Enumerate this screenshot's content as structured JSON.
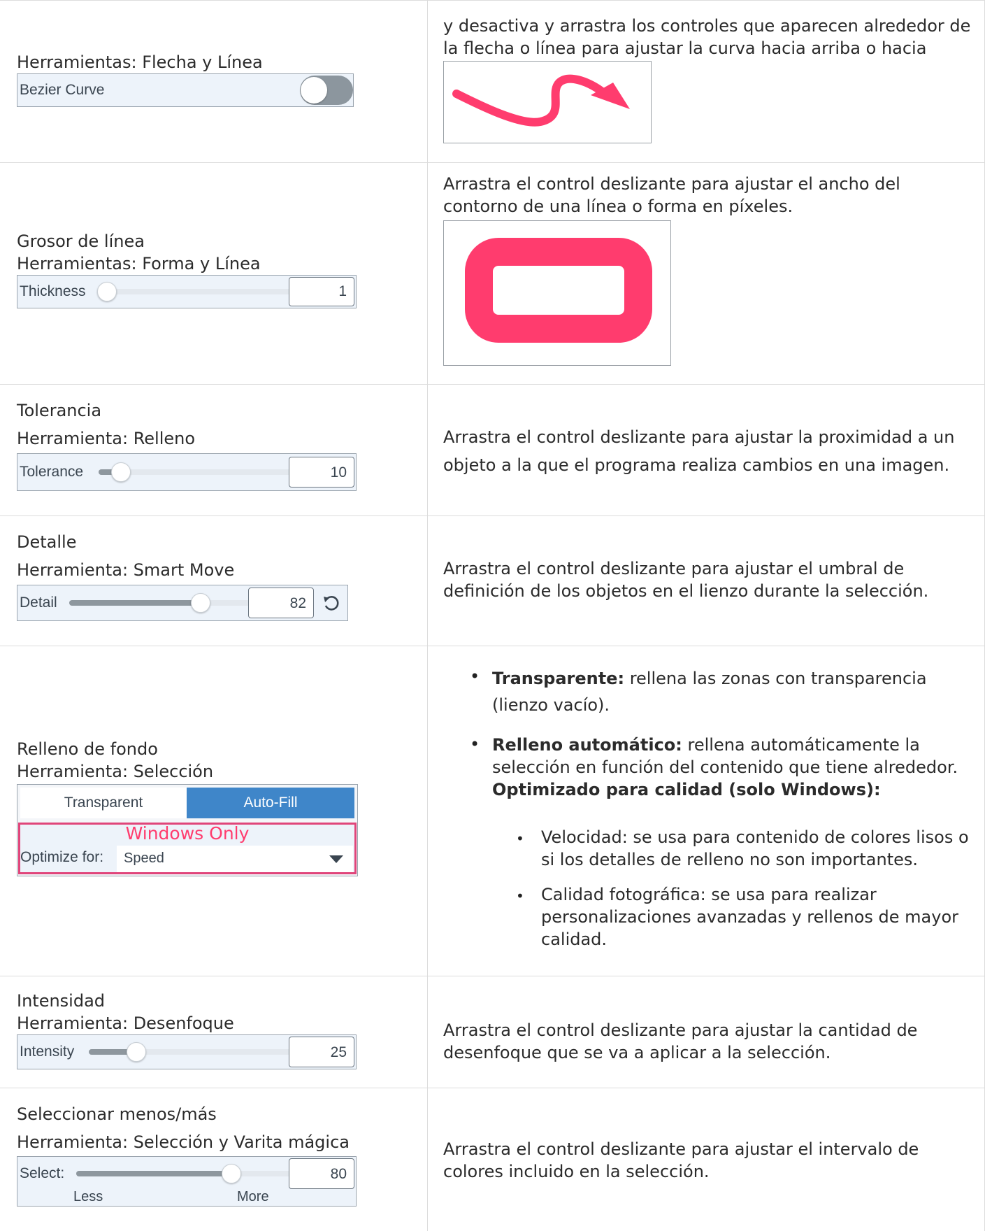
{
  "rows": [
    {
      "left_lines": [
        "Herramientas: Flecha y Línea"
      ],
      "control": {
        "label": "Bezier Curve",
        "toggle_on": false
      },
      "description": "y desactiva y arrastra los controles que aparecen alrededor de la flecha o línea para ajustar la curva hacia arriba o hacia abajo."
    },
    {
      "left_lines": [
        "Grosor de línea",
        "Herramientas: Forma y Línea"
      ],
      "control": {
        "label": "Thickness",
        "value": "1",
        "level": 0.0
      },
      "description": "Arrastra el control deslizante para ajustar el ancho del contorno de una línea o forma en píxeles."
    },
    {
      "left_lines": [
        "Tolerancia",
        "Herramienta: Relleno"
      ],
      "control": {
        "label": "Tolerance",
        "value": "10",
        "level": 0.1
      },
      "description": "Arrastra el control deslizante para ajustar la proximidad a un objeto a la que el programa realiza cambios en una imagen."
    },
    {
      "left_lines": [
        "Detalle",
        "Herramienta: Smart Move"
      ],
      "control": {
        "label": "Detail",
        "value": "82",
        "level": 0.82
      },
      "description": "Arrastra el control deslizante para ajustar el umbral de definición de los objetos en el lienzo durante la selección."
    },
    {
      "left_lines": [
        "Relleno de fondo",
        "Herramienta: Selección"
      ],
      "control": {
        "tab_transparent": "Transparent",
        "tab_autofill": "Auto-Fill",
        "windows_only": "Windows Only",
        "optimize_label": "Optimize for:",
        "optimize_value": "Speed"
      },
      "bullets": [
        {
          "bold": "Transparente:",
          "text": " rellena las zonas con transparencia (lienzo vacío)."
        },
        {
          "bold": "Relleno automático:",
          "text": " rellena automáticamente la selección en función del contenido que tiene alrededor.",
          "bold2": "Optimizado para calidad (solo Windows):"
        }
      ],
      "sub_bullets": [
        "Velocidad: se usa para contenido de colores lisos o si los detalles de relleno no son importantes.",
        "Calidad fotográfica: se usa para realizar personalizaciones avanzadas y rellenos de mayor calidad."
      ]
    },
    {
      "left_lines": [
        "Intensidad",
        "Herramienta: Desenfoque"
      ],
      "control": {
        "label": "Intensity",
        "value": "25",
        "level": 0.25
      },
      "description": "Arrastra el control deslizante para ajustar la cantidad de desenfoque que se va a aplicar a la selección."
    },
    {
      "left_lines": [
        "Seleccionar menos/más",
        "Herramienta: Selección y Varita mágica"
      ],
      "control": {
        "label": "Select:",
        "value": "80",
        "level": 0.8,
        "less": "Less",
        "more": "More"
      },
      "description": "Arrastra el control deslizante para ajustar el intervalo de colores incluido en la selección."
    }
  ],
  "colors": {
    "accent_pink": "#ff3c6e",
    "tab_selected": "#3f86c9",
    "panel_bg": "#edf3fa",
    "windows_only_border": "#e0457a"
  }
}
